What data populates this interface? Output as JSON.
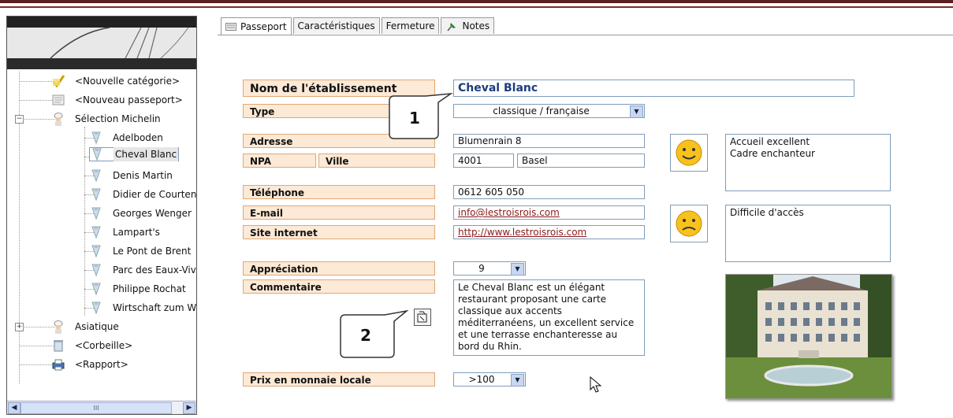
{
  "tabs": [
    {
      "label": "Passeport",
      "icon": "passport-icon",
      "active": true
    },
    {
      "label": "Caractéristiques",
      "icon": "",
      "active": false
    },
    {
      "label": "Fermeture",
      "icon": "",
      "active": false
    },
    {
      "label": "Notes",
      "icon": "pin-icon",
      "active": false
    }
  ],
  "tree": {
    "items": [
      {
        "label": "<Nouvelle catégorie>",
        "icon": "new-category-icon"
      },
      {
        "label": "<Nouveau passeport>",
        "icon": "new-passport-icon"
      },
      {
        "label": "Sélection Michelin",
        "icon": "chef-icon",
        "expander": "−"
      },
      {
        "label": "Adelboden",
        "icon": "restaurant-icon"
      },
      {
        "label": "Cheval Blanc",
        "icon": "restaurant-icon",
        "selected": true
      },
      {
        "label": "Denis Martin",
        "icon": "restaurant-icon"
      },
      {
        "label": "Didier de Courten",
        "icon": "restaurant-icon"
      },
      {
        "label": "Georges Wenger",
        "icon": "restaurant-icon"
      },
      {
        "label": "Lampart's",
        "icon": "restaurant-icon"
      },
      {
        "label": "Le Pont de Brent",
        "icon": "restaurant-icon"
      },
      {
        "label": "Parc des Eaux-Vives",
        "icon": "restaurant-icon"
      },
      {
        "label": "Philippe Rochat",
        "icon": "restaurant-icon"
      },
      {
        "label": "Wirtschaft zum Wiese",
        "icon": "restaurant-icon"
      },
      {
        "label": "Asiatique",
        "icon": "chef-icon",
        "expander": "+"
      },
      {
        "label": "<Corbeille>",
        "icon": "trash-icon"
      },
      {
        "label": "<Rapport>",
        "icon": "printer-icon"
      }
    ],
    "scroll_thumb": "III"
  },
  "form": {
    "name_label": "Nom de l'établissement",
    "name_value": "Cheval Blanc",
    "type_label": "Type",
    "type_value": "classique / française",
    "address_label": "Adresse",
    "address_value": "Blumenrain 8",
    "npa_label": "NPA",
    "npa_value": "4001",
    "city_label": "Ville",
    "city_value": "Basel",
    "phone_label": "Téléphone",
    "phone_value": "0612 605 050",
    "email_label": "E-mail",
    "email_value": "info@lestroisrois.com",
    "website_label": "Site internet",
    "website_value": "http://www.lestroisrois.com",
    "rating_label": "Appréciation",
    "rating_value": "9",
    "comment_label": "Commentaire",
    "comment_value": "Le Cheval Blanc est un élégant restaurant proposant une carte classique aux accents méditerranéens, un excellent service et une terrasse enchanteresse au bord du Rhin.",
    "price_label": "Prix en monnaie locale",
    "price_value": ">100",
    "positive_note": "Accueil excellent\nCadre enchanteur",
    "negative_note": "Difficile d'accès"
  },
  "callouts": [
    {
      "number": "1"
    },
    {
      "number": "2"
    }
  ],
  "colors": {
    "label_bg": "#fce9d6",
    "label_border": "#e0a878",
    "name_text": "#1c3c7c",
    "link_text": "#8b1a1a",
    "top_bar": "#5a1f1f"
  }
}
